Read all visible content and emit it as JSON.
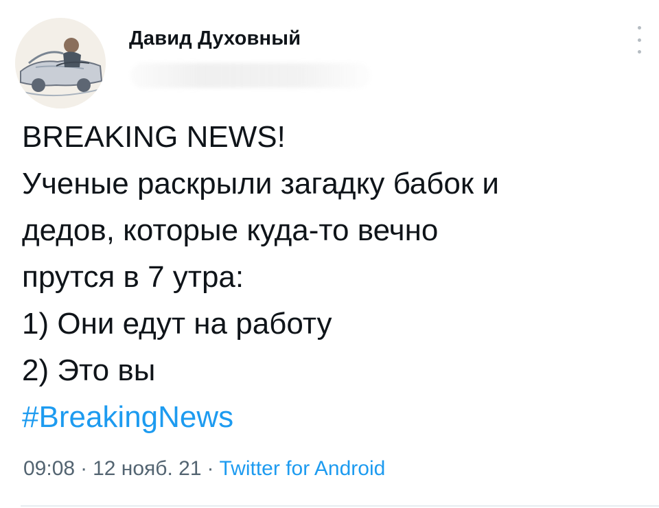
{
  "author": {
    "name": "Давид Духовный"
  },
  "tweet": {
    "lines": [
      "BREAKING NEWS!",
      "Ученые раскрыли загадку бабок и",
      "дедов, которые куда-то вечно",
      "прутся в 7 утра:",
      "1) Они едут на работу",
      "2) Это вы"
    ],
    "hashtag": "#BreakingNews"
  },
  "meta": {
    "time": "09:08",
    "separator": "·",
    "date": "12 нояб. 21",
    "source": "Twitter for Android"
  },
  "colors": {
    "text": "#0f1419",
    "link": "#1d9bf0",
    "muted": "#536471"
  },
  "icons": {
    "more": "more-vertical-icon"
  }
}
